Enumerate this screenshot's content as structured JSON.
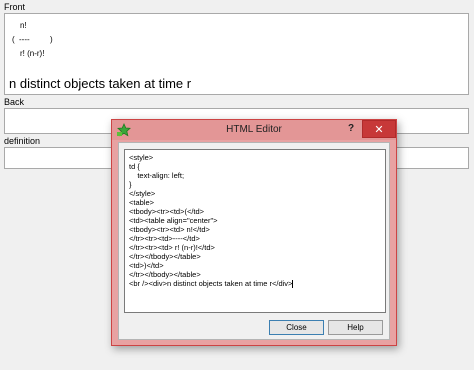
{
  "fields": {
    "front_label": "Front",
    "back_label": "Back",
    "definition_label": "definition",
    "front_content": {
      "numerator": "n!",
      "paren_open": "(",
      "frac_bar": "----",
      "paren_close": ")",
      "denominator": "r! (n-r)!",
      "caption": "n distinct objects taken at time r"
    }
  },
  "dialog": {
    "title": "HTML Editor",
    "help_glyph": "?",
    "close_glyph": "✕",
    "code_lines": [
      "<style>",
      "td {",
      "    text-align: left;",
      "}",
      "</style>",
      "<table>",
      "<tbody><tr><td>(</td>",
      "<td><table align=\"center\">",
      "<tbody><tr><td> n!</td>",
      "</tr><tr><td>----</td>",
      "</tr><tr><td> r! (n-r)!</td>",
      "</tr></tbody></table>",
      "<td>)</td>",
      "</tr></tbody></table>",
      "<br /><div>n distinct objects taken at time r</div>"
    ],
    "close_button": "Close",
    "help_button": "Help"
  }
}
